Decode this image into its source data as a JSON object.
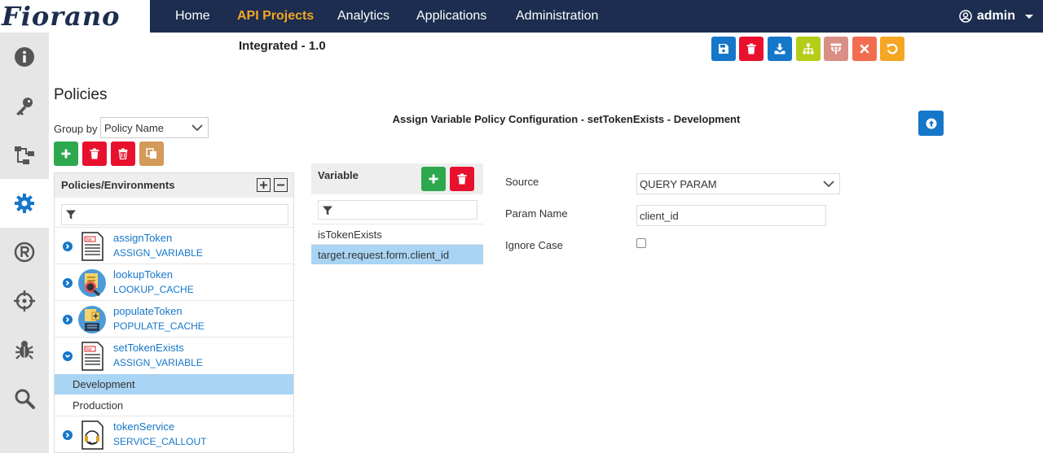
{
  "app": {
    "logo_text": "Fiorano",
    "nav": [
      {
        "label": "Home"
      },
      {
        "label": "API Projects"
      },
      {
        "label": "Analytics"
      },
      {
        "label": "Applications"
      },
      {
        "label": "Administration"
      }
    ],
    "active_nav": "API Projects",
    "user": "admin"
  },
  "sidebar": {
    "items": [
      {
        "icon": "info-icon"
      },
      {
        "icon": "key-icon"
      },
      {
        "icon": "flow-icon"
      },
      {
        "icon": "gear-icon",
        "active": true
      },
      {
        "icon": "registered-icon"
      },
      {
        "icon": "crosshair-icon"
      },
      {
        "icon": "bug-icon"
      },
      {
        "icon": "search-icon"
      }
    ]
  },
  "project": {
    "title": "Integrated - 1.0",
    "toolbar": [
      {
        "icon": "save-icon",
        "color": "#1577c9"
      },
      {
        "icon": "delete-icon",
        "color": "#e8112d"
      },
      {
        "icon": "download-icon",
        "color": "#1577c9"
      },
      {
        "icon": "sitemap-icon",
        "color": "#b5cc18"
      },
      {
        "icon": "hierarchy-icon",
        "color": "#d98e86"
      },
      {
        "icon": "close-icon",
        "color": "#f26d4f"
      },
      {
        "icon": "undo-icon",
        "color": "#f5a623"
      }
    ]
  },
  "policies": {
    "title": "Policies",
    "group_by_label": "Group by",
    "group_by_value": "Policy Name",
    "tree_title": "Policies/Environments",
    "items": [
      {
        "name": "assignToken",
        "type": "ASSIGN_VARIABLE",
        "icon": "variable-doc-icon",
        "expanded": false
      },
      {
        "name": "lookupToken",
        "type": "LOOKUP_CACHE",
        "icon": "lookup-cache-icon",
        "expanded": false
      },
      {
        "name": "populateToken",
        "type": "POPULATE_CACHE",
        "icon": "populate-cache-icon",
        "expanded": false
      },
      {
        "name": "setTokenExists",
        "type": "ASSIGN_VARIABLE",
        "icon": "variable-doc-icon",
        "expanded": true
      },
      {
        "name": "tokenService",
        "type": "SERVICE_CALLOUT",
        "icon": "service-callout-icon",
        "expanded": false
      }
    ],
    "environments": [
      {
        "label": "Development",
        "selected": true
      },
      {
        "label": "Production",
        "selected": false
      }
    ]
  },
  "variables": {
    "title": "Variable",
    "items": [
      {
        "label": "isTokenExists",
        "selected": false
      },
      {
        "label": "target.request.form.client_id",
        "selected": true
      }
    ]
  },
  "config": {
    "title": "Assign Variable Policy Configuration - setTokenExists - Development",
    "source_label": "Source",
    "source_value": "QUERY PARAM",
    "param_name_label": "Param Name",
    "param_name_value": "client_id",
    "ignore_case_label": "Ignore Case",
    "ignore_case_checked": false
  }
}
